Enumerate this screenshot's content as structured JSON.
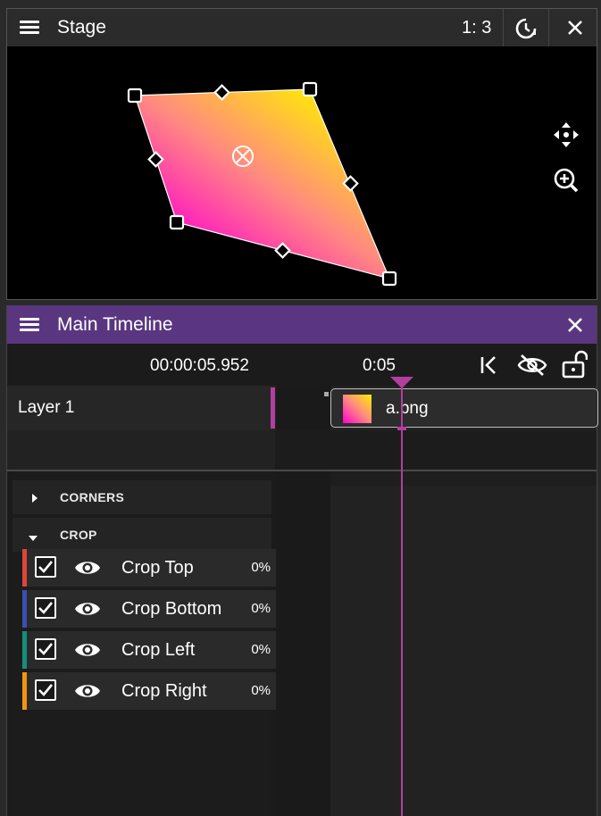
{
  "stage": {
    "title": "Stage",
    "ratio": "1: 3",
    "icons": [
      "menu-icon",
      "clock-icon",
      "close-icon",
      "move-icon",
      "zoom-in-icon"
    ],
    "gradient": [
      "#ff00d0",
      "#ff8a80",
      "#ffee00"
    ]
  },
  "timeline": {
    "title": "Main Timeline",
    "timecode": "00:00:05.952",
    "ruler_mark": "0:05",
    "accent": "#5a3680",
    "playhead_color": "#b23fa0",
    "layer": {
      "label": "Layer 1",
      "clip_name": "a.png"
    },
    "sections": [
      {
        "label": "CORNERS",
        "expanded": false
      },
      {
        "label": "CROP",
        "expanded": true
      }
    ],
    "properties": [
      {
        "label": "Crop Top",
        "value": "0%",
        "color": "#e0443a",
        "checked": true
      },
      {
        "label": "Crop Bottom",
        "value": "0%",
        "color": "#3d4fb0",
        "checked": true
      },
      {
        "label": "Crop Left",
        "value": "0%",
        "color": "#14907a",
        "checked": true
      },
      {
        "label": "Crop Right",
        "value": "0%",
        "color": "#f2950e",
        "checked": true
      }
    ]
  }
}
